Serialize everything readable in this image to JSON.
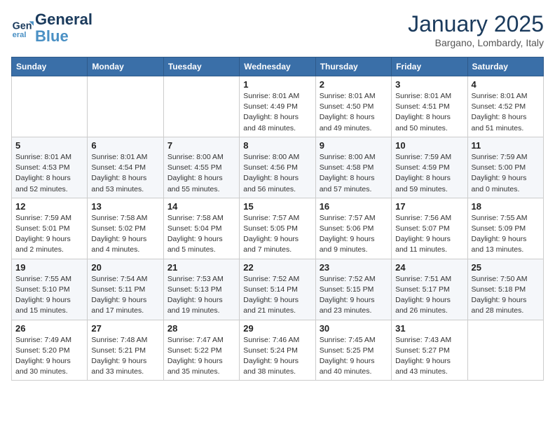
{
  "header": {
    "logo_line1": "General",
    "logo_line2": "Blue",
    "month": "January 2025",
    "location": "Bargano, Lombardy, Italy"
  },
  "weekdays": [
    "Sunday",
    "Monday",
    "Tuesday",
    "Wednesday",
    "Thursday",
    "Friday",
    "Saturday"
  ],
  "weeks": [
    [
      {
        "day": "",
        "info": ""
      },
      {
        "day": "",
        "info": ""
      },
      {
        "day": "",
        "info": ""
      },
      {
        "day": "1",
        "info": "Sunrise: 8:01 AM\nSunset: 4:49 PM\nDaylight: 8 hours\nand 48 minutes."
      },
      {
        "day": "2",
        "info": "Sunrise: 8:01 AM\nSunset: 4:50 PM\nDaylight: 8 hours\nand 49 minutes."
      },
      {
        "day": "3",
        "info": "Sunrise: 8:01 AM\nSunset: 4:51 PM\nDaylight: 8 hours\nand 50 minutes."
      },
      {
        "day": "4",
        "info": "Sunrise: 8:01 AM\nSunset: 4:52 PM\nDaylight: 8 hours\nand 51 minutes."
      }
    ],
    [
      {
        "day": "5",
        "info": "Sunrise: 8:01 AM\nSunset: 4:53 PM\nDaylight: 8 hours\nand 52 minutes."
      },
      {
        "day": "6",
        "info": "Sunrise: 8:01 AM\nSunset: 4:54 PM\nDaylight: 8 hours\nand 53 minutes."
      },
      {
        "day": "7",
        "info": "Sunrise: 8:00 AM\nSunset: 4:55 PM\nDaylight: 8 hours\nand 55 minutes."
      },
      {
        "day": "8",
        "info": "Sunrise: 8:00 AM\nSunset: 4:56 PM\nDaylight: 8 hours\nand 56 minutes."
      },
      {
        "day": "9",
        "info": "Sunrise: 8:00 AM\nSunset: 4:58 PM\nDaylight: 8 hours\nand 57 minutes."
      },
      {
        "day": "10",
        "info": "Sunrise: 7:59 AM\nSunset: 4:59 PM\nDaylight: 8 hours\nand 59 minutes."
      },
      {
        "day": "11",
        "info": "Sunrise: 7:59 AM\nSunset: 5:00 PM\nDaylight: 9 hours\nand 0 minutes."
      }
    ],
    [
      {
        "day": "12",
        "info": "Sunrise: 7:59 AM\nSunset: 5:01 PM\nDaylight: 9 hours\nand 2 minutes."
      },
      {
        "day": "13",
        "info": "Sunrise: 7:58 AM\nSunset: 5:02 PM\nDaylight: 9 hours\nand 4 minutes."
      },
      {
        "day": "14",
        "info": "Sunrise: 7:58 AM\nSunset: 5:04 PM\nDaylight: 9 hours\nand 5 minutes."
      },
      {
        "day": "15",
        "info": "Sunrise: 7:57 AM\nSunset: 5:05 PM\nDaylight: 9 hours\nand 7 minutes."
      },
      {
        "day": "16",
        "info": "Sunrise: 7:57 AM\nSunset: 5:06 PM\nDaylight: 9 hours\nand 9 minutes."
      },
      {
        "day": "17",
        "info": "Sunrise: 7:56 AM\nSunset: 5:07 PM\nDaylight: 9 hours\nand 11 minutes."
      },
      {
        "day": "18",
        "info": "Sunrise: 7:55 AM\nSunset: 5:09 PM\nDaylight: 9 hours\nand 13 minutes."
      }
    ],
    [
      {
        "day": "19",
        "info": "Sunrise: 7:55 AM\nSunset: 5:10 PM\nDaylight: 9 hours\nand 15 minutes."
      },
      {
        "day": "20",
        "info": "Sunrise: 7:54 AM\nSunset: 5:11 PM\nDaylight: 9 hours\nand 17 minutes."
      },
      {
        "day": "21",
        "info": "Sunrise: 7:53 AM\nSunset: 5:13 PM\nDaylight: 9 hours\nand 19 minutes."
      },
      {
        "day": "22",
        "info": "Sunrise: 7:52 AM\nSunset: 5:14 PM\nDaylight: 9 hours\nand 21 minutes."
      },
      {
        "day": "23",
        "info": "Sunrise: 7:52 AM\nSunset: 5:15 PM\nDaylight: 9 hours\nand 23 minutes."
      },
      {
        "day": "24",
        "info": "Sunrise: 7:51 AM\nSunset: 5:17 PM\nDaylight: 9 hours\nand 26 minutes."
      },
      {
        "day": "25",
        "info": "Sunrise: 7:50 AM\nSunset: 5:18 PM\nDaylight: 9 hours\nand 28 minutes."
      }
    ],
    [
      {
        "day": "26",
        "info": "Sunrise: 7:49 AM\nSunset: 5:20 PM\nDaylight: 9 hours\nand 30 minutes."
      },
      {
        "day": "27",
        "info": "Sunrise: 7:48 AM\nSunset: 5:21 PM\nDaylight: 9 hours\nand 33 minutes."
      },
      {
        "day": "28",
        "info": "Sunrise: 7:47 AM\nSunset: 5:22 PM\nDaylight: 9 hours\nand 35 minutes."
      },
      {
        "day": "29",
        "info": "Sunrise: 7:46 AM\nSunset: 5:24 PM\nDaylight: 9 hours\nand 38 minutes."
      },
      {
        "day": "30",
        "info": "Sunrise: 7:45 AM\nSunset: 5:25 PM\nDaylight: 9 hours\nand 40 minutes."
      },
      {
        "day": "31",
        "info": "Sunrise: 7:43 AM\nSunset: 5:27 PM\nDaylight: 9 hours\nand 43 minutes."
      },
      {
        "day": "",
        "info": ""
      }
    ]
  ]
}
